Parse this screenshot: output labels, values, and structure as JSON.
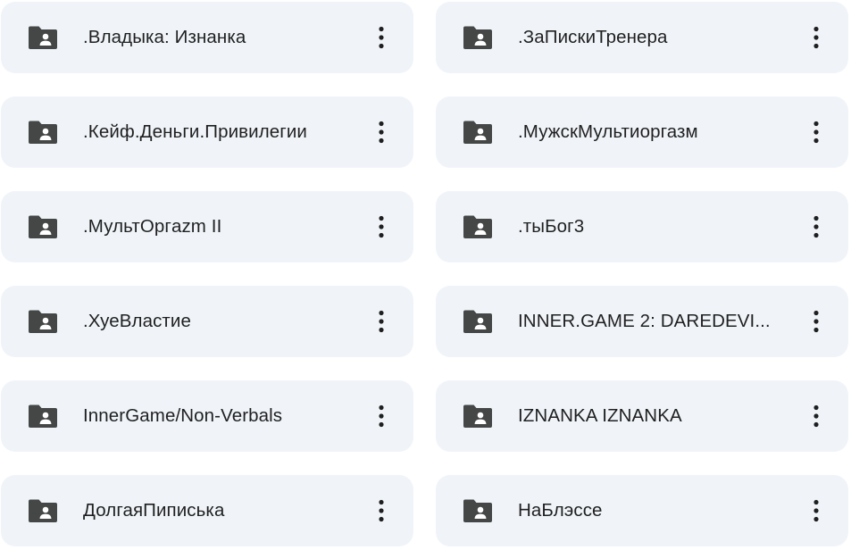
{
  "colors": {
    "card_bg": "#f0f4f9",
    "icon": "#444746",
    "text": "#1f1f1f"
  },
  "folders": [
    {
      "name": ".Владыка: Изнанка",
      "icon": "shared-folder-icon"
    },
    {
      "name": ".ЗаПискиТренера",
      "icon": "shared-folder-icon"
    },
    {
      "name": ".Кейф.Деньги.Привилегии",
      "icon": "shared-folder-icon"
    },
    {
      "name": ".МужскМультиоргазм",
      "icon": "shared-folder-icon"
    },
    {
      "name": ".МультОргazm II",
      "icon": "shared-folder-icon"
    },
    {
      "name": ".тыБог3",
      "icon": "shared-folder-icon"
    },
    {
      "name": ".ХуеВластие",
      "icon": "shared-folder-icon"
    },
    {
      "name": "INNER.GAME 2: DAREDEVI...",
      "icon": "shared-folder-icon"
    },
    {
      "name": "InnerGame/Non-Verbals",
      "icon": "shared-folder-icon"
    },
    {
      "name": "IZNANKA IZNANKA",
      "icon": "shared-folder-icon"
    },
    {
      "name": "ДолгаяПиписька",
      "icon": "shared-folder-icon"
    },
    {
      "name": "НаБлэссе",
      "icon": "shared-folder-icon"
    }
  ]
}
